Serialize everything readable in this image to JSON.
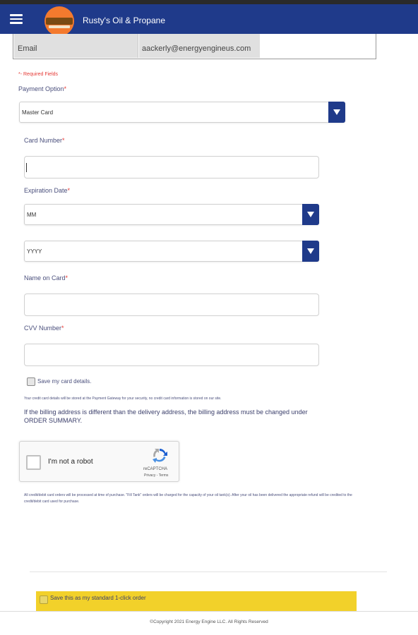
{
  "app": {
    "title": "Rusty's Oil & Propane",
    "menu_icon": "hamburger-menu-icon",
    "logo": "rustys-logo"
  },
  "account": {
    "email_label": "Email",
    "email_value": "aackerly@energyengineus.com"
  },
  "form": {
    "required_note": "*- Required Fields",
    "payment_option": {
      "label": "Payment Option",
      "selected": "Master Card"
    },
    "card_number": {
      "label": "Card Number",
      "value": ""
    },
    "expiration": {
      "label": "Expiration Date",
      "month": "MM",
      "year": "YYYY"
    },
    "name_on_card": {
      "label": "Name on Card",
      "value": ""
    },
    "cvv": {
      "label": "CVV Number",
      "value": ""
    },
    "save_card": {
      "label": "Save my card details.",
      "checked": false
    },
    "security_note": "Your credit card details will be stored at the Payment Gateway for your security, no credit card information is stored on our site.",
    "billing_note": "If the billing address is different than the delivery address, the billing address must be changed under ORDER SUMMARY."
  },
  "recaptcha": {
    "label": "I'm not a robot",
    "brand": "reCAPTCHA",
    "links": "Privacy - Terms"
  },
  "processing_note": "All credit/debit card orders will be processed at time of purchase. \"Fill Tank\" orders will be charged for the capacity of your oil tank(s). After your oil has been delivered the appropriate refund will be credited to the credit/debit card used for purchase.",
  "one_click": {
    "label": "Save this as my standard 1-click order",
    "checked": false,
    "bar_color": "#f2d12a"
  },
  "footer": {
    "copyright": "©Copyright 2021 Energy Engine LLC. All Rights Reserved"
  },
  "colors": {
    "primary": "#1f3a8a",
    "required": "#e53935",
    "text": "#3b3f6b"
  }
}
